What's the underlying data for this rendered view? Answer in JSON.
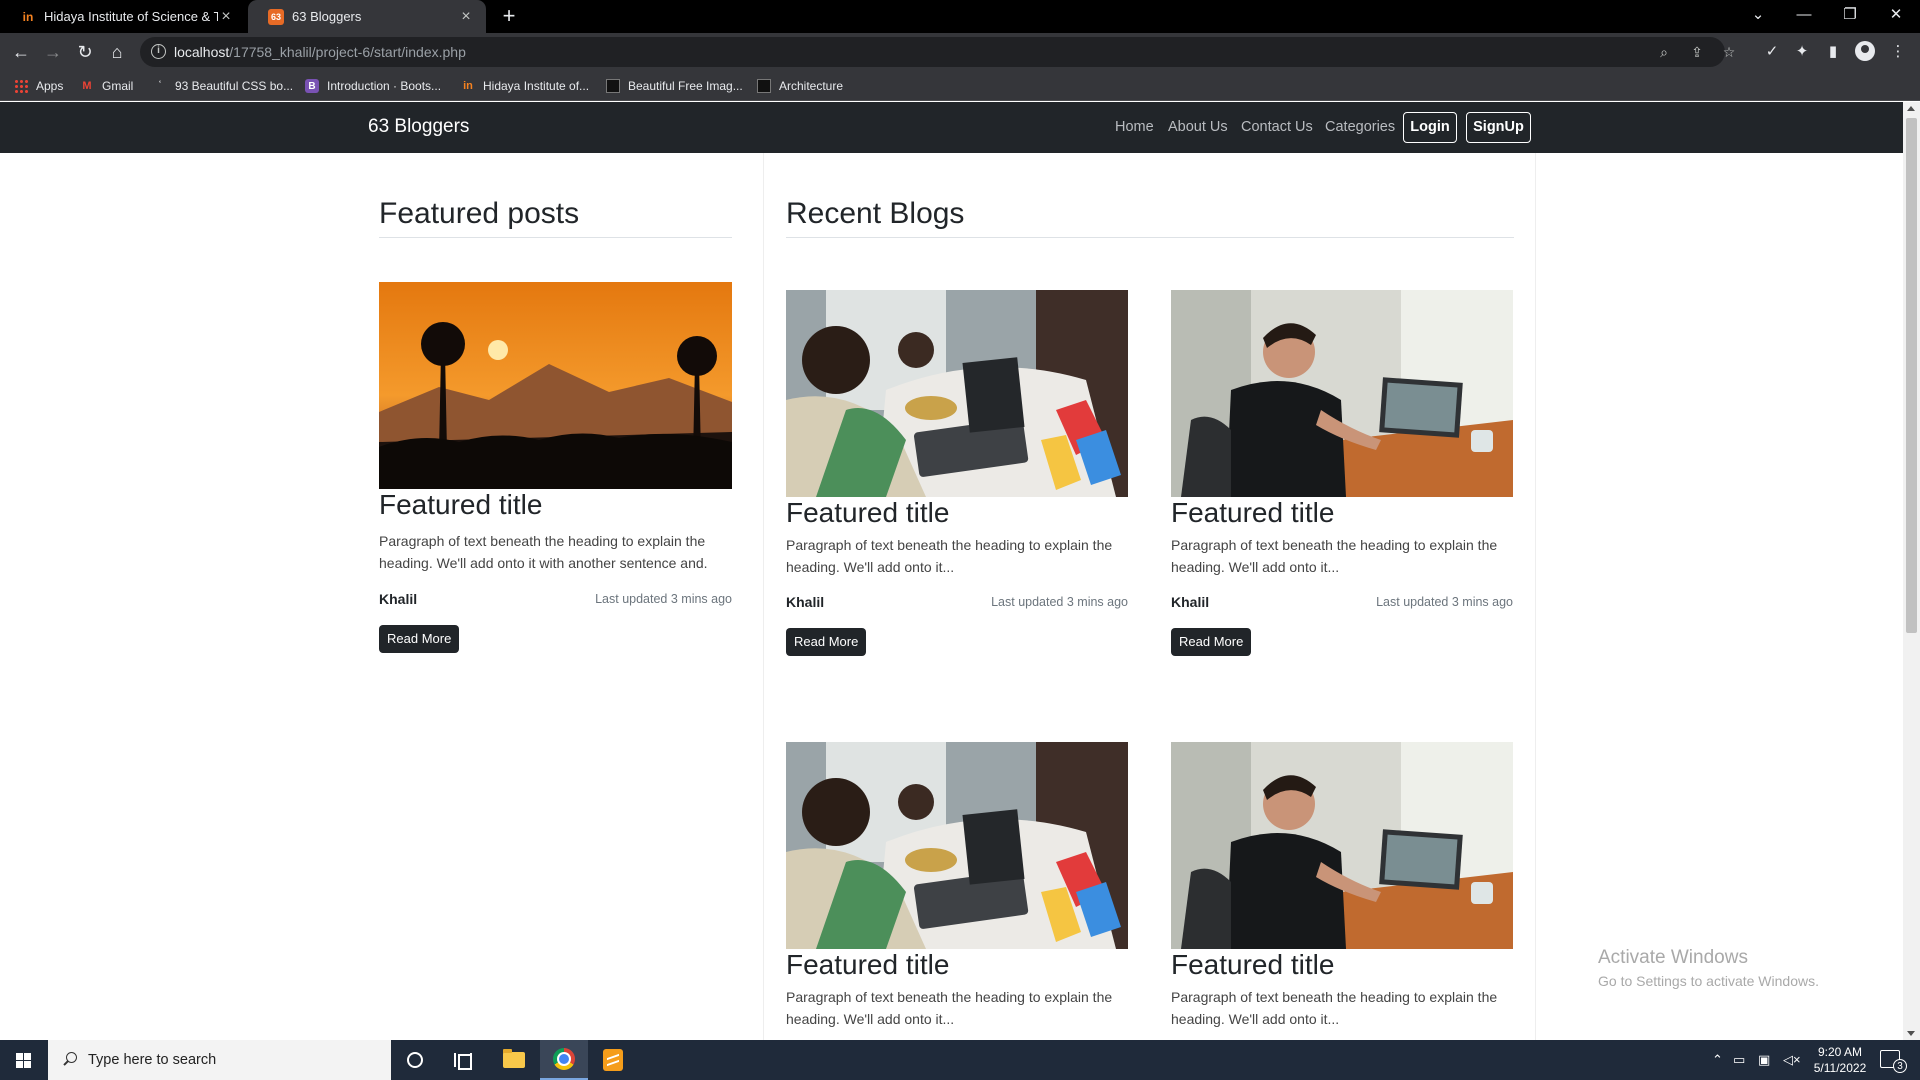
{
  "browser": {
    "tabs": [
      {
        "title": "Hidaya Institute of Science & Tec",
        "favicon": "hidaya-icon",
        "active": false
      },
      {
        "title": "63 Bloggers",
        "favicon": "bootstrap-icon",
        "active": true
      }
    ],
    "url_host": "localhost",
    "url_path": "/17758_khalil/project-6/start/index.php",
    "bookmarks": [
      "Apps",
      "Gmail",
      "93 Beautiful CSS bo...",
      "Introduction · Boots...",
      "Hidaya Institute of...",
      "Beautiful Free Imag...",
      "Architecture"
    ]
  },
  "site": {
    "brand": "63 Bloggers",
    "nav": [
      "Home",
      "About Us",
      "Contact Us",
      "Categories"
    ],
    "login_label": "Login",
    "signup_label": "SignUp",
    "featured_heading": "Featured posts",
    "recent_heading": "Recent Blogs",
    "featured_post": {
      "title": "Featured title",
      "text": "Paragraph of text beneath the heading to explain the heading. We'll add onto it with another sentence and.",
      "author": "Khalil",
      "updated": "Last updated 3 mins ago",
      "button": "Read More"
    },
    "recent_posts": [
      {
        "title": "Featured title",
        "text": "Paragraph of text beneath the heading to explain the heading. We'll add onto it...",
        "author": "Khalil",
        "updated": "Last updated 3 mins ago",
        "button": "Read More",
        "image": "couple-laptop-photo"
      },
      {
        "title": "Featured title",
        "text": "Paragraph of text beneath the heading to explain the heading. We'll add onto it...",
        "author": "Khalil",
        "updated": "Last updated 3 mins ago",
        "button": "Read More",
        "image": "man-laptop-photo"
      },
      {
        "title": "Featured title",
        "text": "Paragraph of text beneath the heading to explain the heading. We'll add onto it...",
        "image": "couple-laptop-photo"
      },
      {
        "title": "Featured title",
        "text": "Paragraph of text beneath the heading to explain the heading. We'll add onto it...",
        "image": "man-laptop-photo"
      }
    ]
  },
  "watermark": {
    "line1": "Activate Windows",
    "line2": "Go to Settings to activate Windows."
  },
  "taskbar": {
    "search_placeholder": "Type here to search",
    "time": "9:20 AM",
    "date": "5/11/2022",
    "notification_count": "3"
  },
  "colors": {
    "navbar_bg": "#212529",
    "browser_toolbar": "#35363a",
    "taskbar": "#1f2a3a"
  }
}
